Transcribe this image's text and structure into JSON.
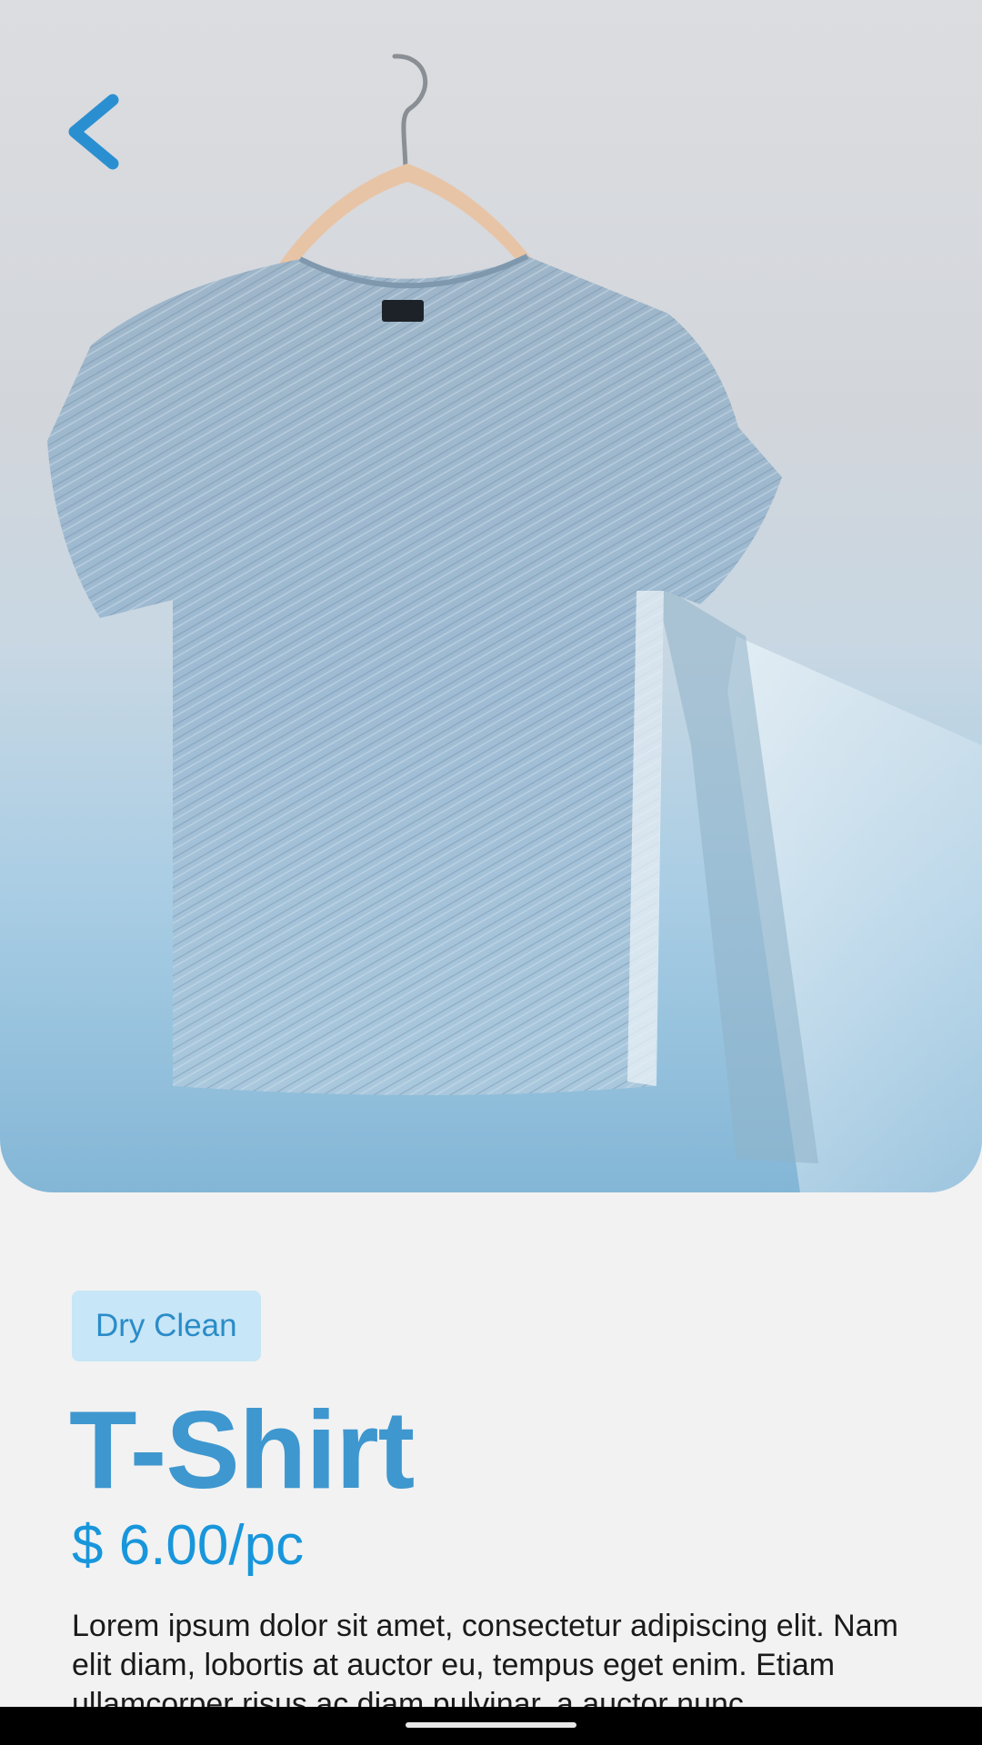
{
  "hero": {
    "image_alt": "Light blue heathered t-shirt hanging on a wooden hanger against a wall",
    "back_icon": "chevron-left-icon",
    "accent_color": "#2a8fd0"
  },
  "service": {
    "badge_label": "Dry Clean"
  },
  "product": {
    "title": "T-Shirt",
    "price": "$ 6.00/pc",
    "description": "Lorem ipsum dolor sit amet, consectetur adipiscing elit. Nam elit diam, lobortis at auctor eu, tempus eget enim. Etiam ullamcorper risus ac diam pulvinar, a auctor nunc."
  },
  "colors": {
    "title": "#3e97cf",
    "price": "#1896dc",
    "badge_bg": "#c7e6f7",
    "badge_text": "#2a8cc8",
    "background": "#f2f2f2"
  }
}
